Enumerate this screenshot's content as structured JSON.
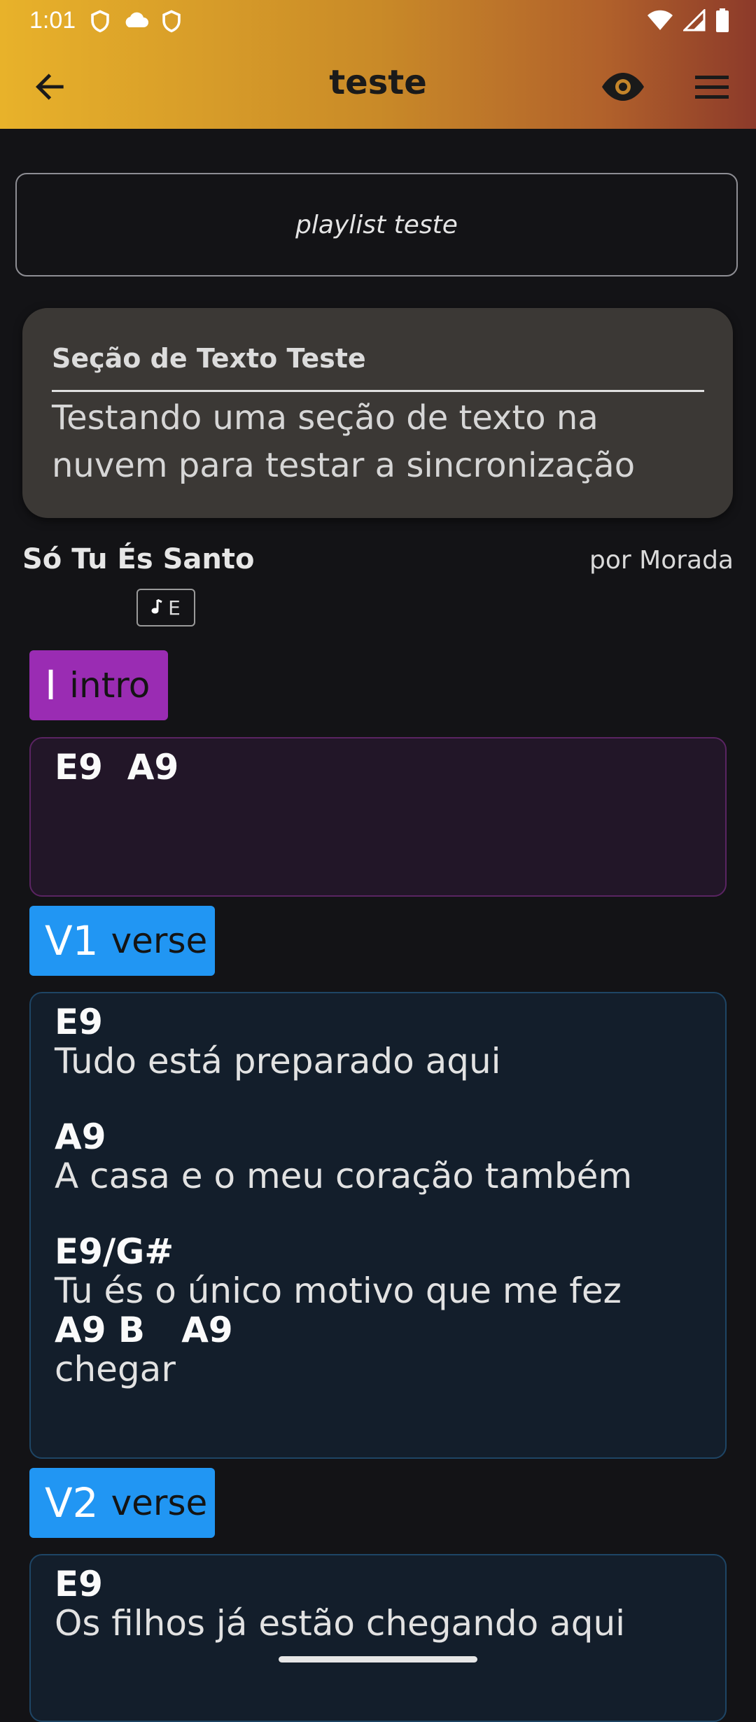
{
  "status_bar": {
    "time": "1:01",
    "left_icons": [
      "shield-icon",
      "cloud-icon",
      "shield-icon"
    ],
    "right_icons": [
      "wifi-icon",
      "signal-icon",
      "battery-icon"
    ]
  },
  "toolbar": {
    "title": "teste",
    "back_icon": "arrow-left-icon",
    "eye_icon": "eye-icon",
    "menu_icon": "hamburger-menu-icon"
  },
  "playlist": {
    "name": "playlist teste"
  },
  "text_section": {
    "title": "Seção de Texto Teste",
    "body": "Testando uma seção de texto na nuvem para testar a sincronização"
  },
  "song": {
    "title": "Só Tu És Santo",
    "author": "por Morada",
    "key": "E",
    "key_icon": "music-note-icon"
  },
  "sections": {
    "intro": {
      "abbr": "I",
      "name": "intro",
      "color": "#9a2cb3",
      "lines": [
        {
          "chords": "E9  A9"
        }
      ]
    },
    "v1": {
      "abbr": "V1",
      "name": "verse",
      "color": "#2196f3",
      "lines": [
        {
          "chords": "E9",
          "lyric": "Tudo está preparado aqui"
        },
        {
          "chords": "A9",
          "lyric": "A casa e o meu coração também"
        },
        {
          "chords": "E9/G#",
          "lyric": "Tu és o único motivo que me fez"
        },
        {
          "chords": "A9 B   A9",
          "lyric": "chegar"
        }
      ]
    },
    "v2": {
      "abbr": "V2",
      "name": "verse",
      "color": "#2196f3",
      "lines": [
        {
          "chords": "E9",
          "lyric": "Os filhos já estão chegando aqui"
        }
      ]
    }
  }
}
